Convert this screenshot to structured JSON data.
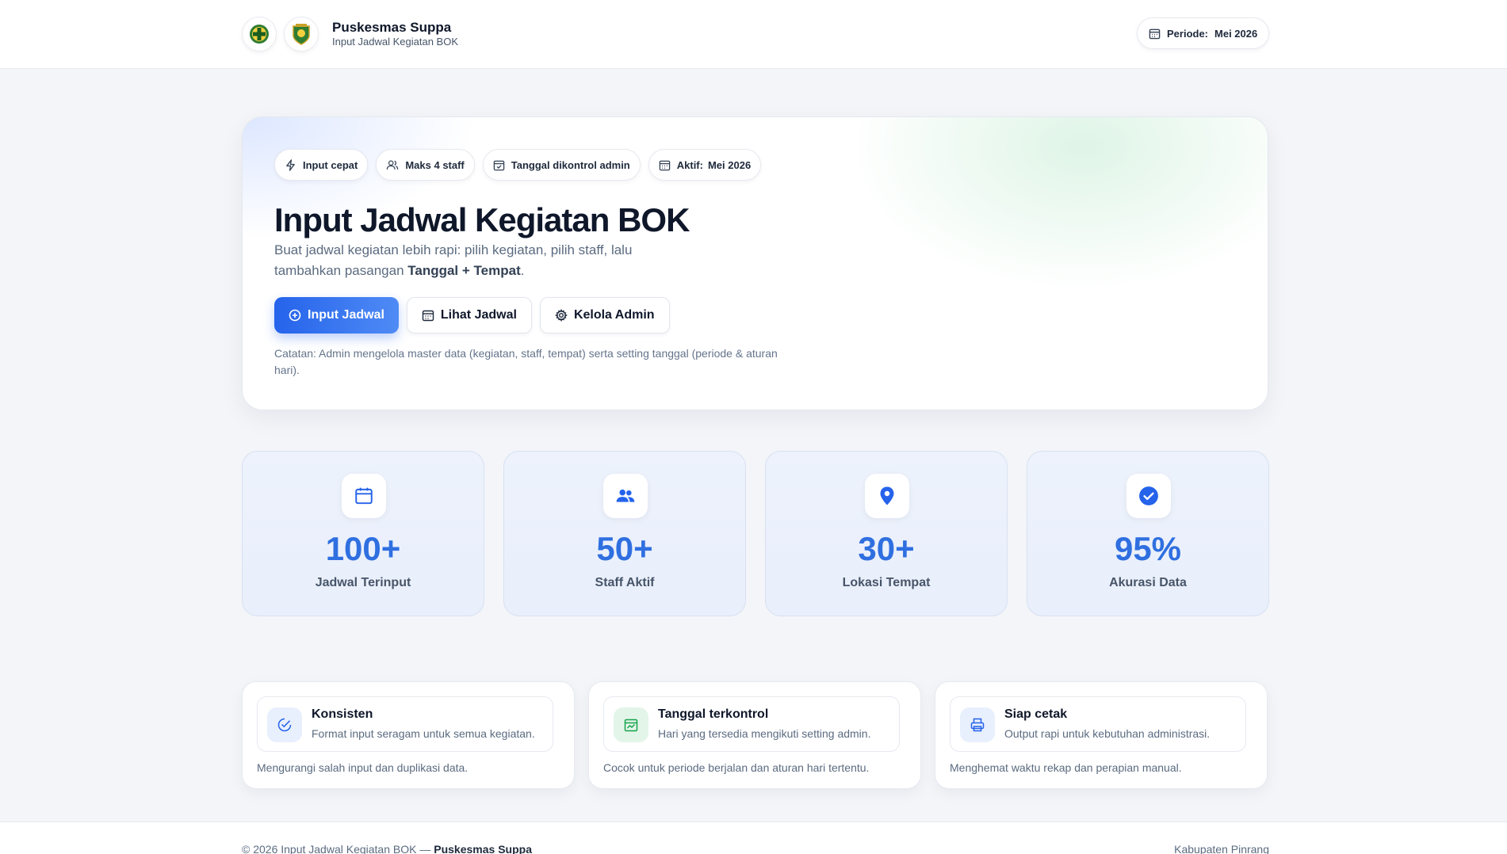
{
  "header": {
    "title": "Puskesmas Suppa",
    "subtitle": "Input Jadwal Kegiatan BOK",
    "period_label": "Periode:",
    "period_value": "Mei 2026"
  },
  "hero": {
    "chips": [
      {
        "label": "Input cepat",
        "icon": "lightning-icon"
      },
      {
        "label": "Maks 4 staff",
        "icon": "users-icon"
      },
      {
        "label": "Tanggal dikontrol admin",
        "icon": "calendar-check-icon"
      },
      {
        "label": "Aktif:",
        "value": "Mei 2026",
        "icon": "calendar-icon"
      }
    ],
    "title": "Input Jadwal Kegiatan BOK",
    "desc_part1": "Buat jadwal kegiatan lebih rapi: pilih kegiatan, pilih staff, lalu tambahkan pasangan ",
    "desc_bold": "Tanggal + Tempat",
    "desc_part2": ".",
    "buttons": {
      "input": "Input Jadwal",
      "view": "Lihat Jadwal",
      "admin": "Kelola Admin"
    },
    "note": "Catatan: Admin mengelola master data (kegiatan, staff, tempat) serta setting tanggal (periode & aturan hari)."
  },
  "stats": [
    {
      "value": "100+",
      "label": "Jadwal Terinput",
      "icon": "calendar-icon"
    },
    {
      "value": "50+",
      "label": "Staff Aktif",
      "icon": "users-icon"
    },
    {
      "value": "30+",
      "label": "Lokasi Tempat",
      "icon": "map-pin-icon"
    },
    {
      "value": "95%",
      "label": "Akurasi Data",
      "icon": "check-circle-icon"
    }
  ],
  "features": [
    {
      "title": "Konsisten",
      "sub": "Format input seragam untuk semua kegiatan.",
      "foot": "Mengurangi salah input dan duplikasi data.",
      "icon": "check-badge-icon"
    },
    {
      "title": "Tanggal terkontrol",
      "sub": "Hari yang tersedia mengikuti setting admin.",
      "foot": "Cocok untuk periode berjalan dan aturan hari tertentu.",
      "icon": "calendar-chart-icon"
    },
    {
      "title": "Siap cetak",
      "sub": "Output rapi untuk kebutuhan administrasi.",
      "foot": "Menghemat waktu rekap dan perapian manual.",
      "icon": "printer-icon"
    }
  ],
  "footer": {
    "left_prefix": "© 2026 Input Jadwal Kegiatan BOK — ",
    "left_bold": "Puskesmas Suppa",
    "right": "Kabupaten Pinrang"
  },
  "colors": {
    "primary": "#2563eb",
    "stat_value": "#2f6fe0",
    "stat_bg": "#edf2fc",
    "feature_icon_blue_bg": "#e8effd",
    "feature_icon_green_bg": "#e3f5e9"
  }
}
